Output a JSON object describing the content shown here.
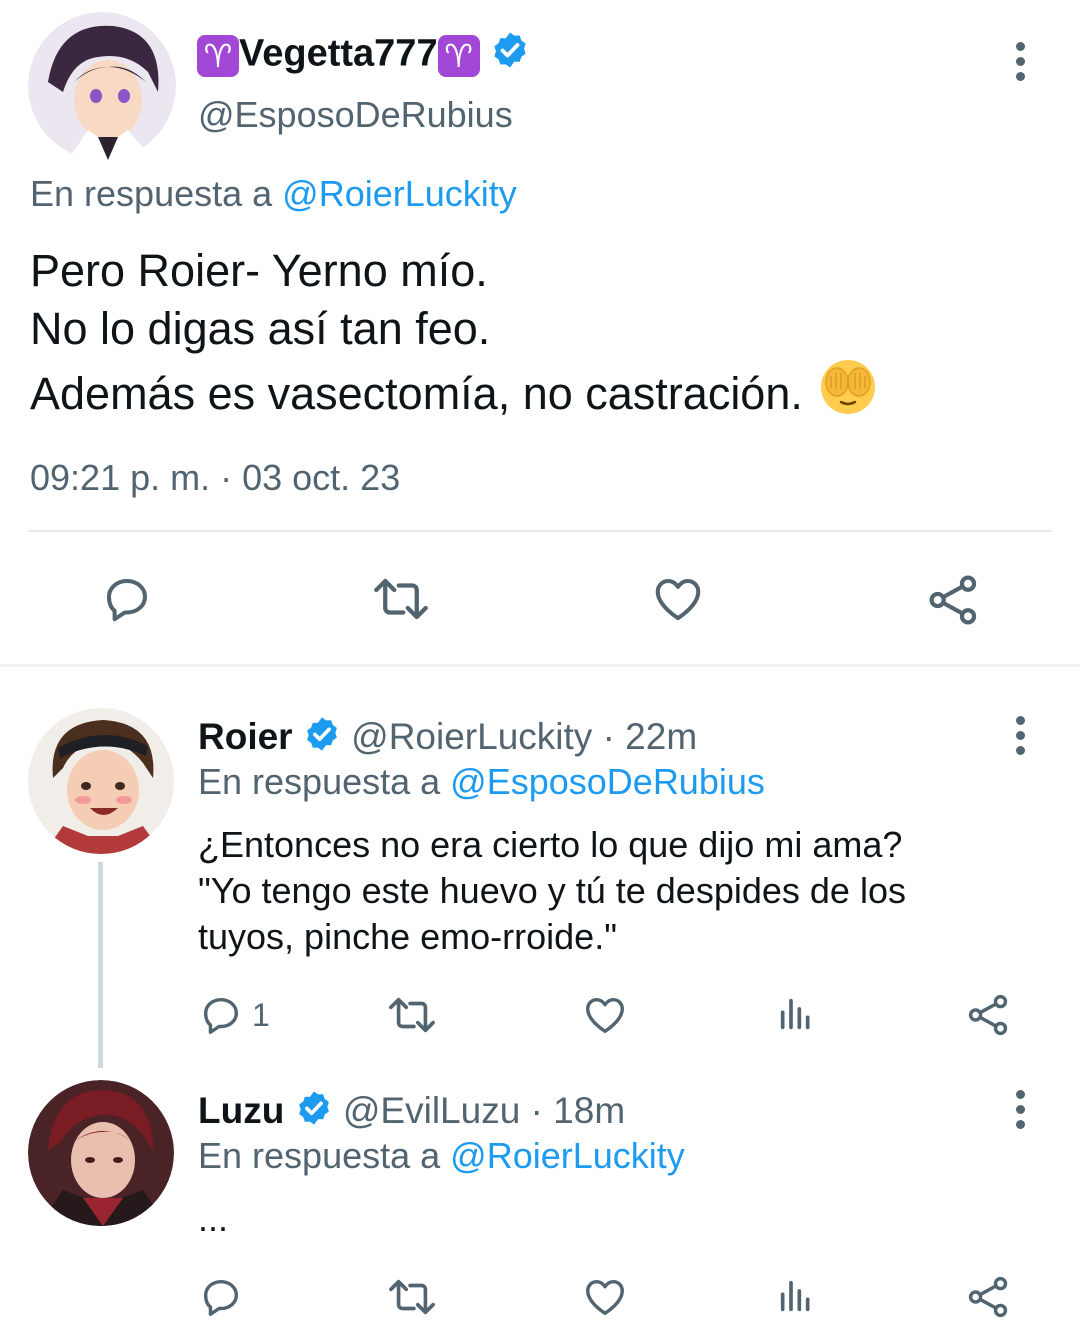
{
  "main_tweet": {
    "display_name": "Vegetta777",
    "name_emoji": "♈",
    "handle": "@EsposoDeRubius",
    "reply_prefix": "En respuesta a",
    "reply_to": "@RoierLuckity",
    "lines": [
      "Pero Roier- Yerno mío.",
      "No lo digas así tan feo.",
      "Además es vasectomía, no castración."
    ],
    "timestamp": "09:21 p. m. · 03 oct. 23"
  },
  "replies": [
    {
      "display_name": "Roier",
      "handle": "@RoierLuckity",
      "time": "· 22m",
      "reply_prefix": "En respuesta a",
      "reply_to": "@EsposoDeRubius",
      "lines": [
        "¿Entonces no era cierto lo que dijo mi ama?",
        "\"Yo tengo este huevo y tú te despides de los",
        "tuyos, pinche emo-rroide.\""
      ],
      "reply_count": "1"
    },
    {
      "display_name": "Luzu",
      "handle": "@EvilLuzu",
      "time": "· 18m",
      "reply_prefix": "En respuesta a",
      "reply_to": "@RoierLuckity",
      "lines": [
        "..."
      ],
      "reply_count": ""
    }
  ],
  "icons": {
    "reply": "reply-icon",
    "retweet": "retweet-icon",
    "like": "heart-icon",
    "share": "share-icon",
    "analytics": "analytics-icon",
    "more": "more-icon",
    "verified": "verified-badge-icon",
    "emoji": "face-with-hands-emoji-icon"
  },
  "colors": {
    "accent": "#1d9bf0",
    "muted": "#536471",
    "divider": "#e6e9eb",
    "aries": "#a347d6"
  }
}
